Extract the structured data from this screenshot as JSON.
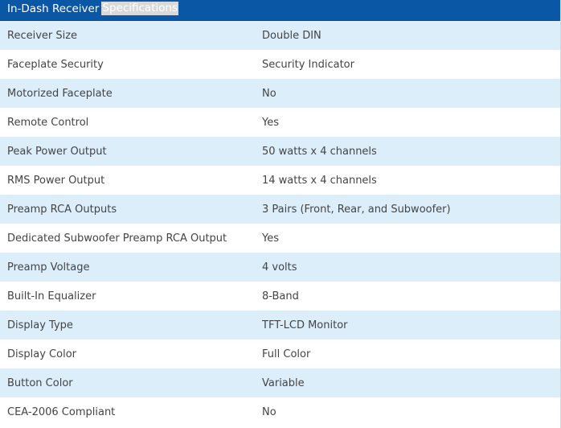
{
  "header": {
    "title_main": "In-Dash Receiver",
    "title_selected": "Specifications",
    "background_color": "#0a57a6",
    "stripe_color": "#ddeefb"
  },
  "rows": [
    {
      "label": "Receiver Size",
      "value": "Double DIN"
    },
    {
      "label": "Faceplate Security",
      "value": "Security Indicator"
    },
    {
      "label": "Motorized Faceplate",
      "value": "No"
    },
    {
      "label": "Remote Control",
      "value": "Yes"
    },
    {
      "label": "Peak Power Output",
      "value": "50 watts x 4 channels"
    },
    {
      "label": "RMS Power Output",
      "value": "14 watts x 4 channels"
    },
    {
      "label": "Preamp RCA Outputs",
      "value": "3 Pairs (Front, Rear, and Subwoofer)"
    },
    {
      "label": "Dedicated Subwoofer Preamp RCA Output",
      "value": "Yes"
    },
    {
      "label": "Preamp Voltage",
      "value": "4 volts"
    },
    {
      "label": "Built-In Equalizer",
      "value": "8-Band"
    },
    {
      "label": "Display Type",
      "value": "TFT-LCD Monitor"
    },
    {
      "label": "Display Color",
      "value": "Full Color"
    },
    {
      "label": "Button Color",
      "value": "Variable"
    },
    {
      "label": "CEA-2006 Compliant",
      "value": "No"
    }
  ]
}
